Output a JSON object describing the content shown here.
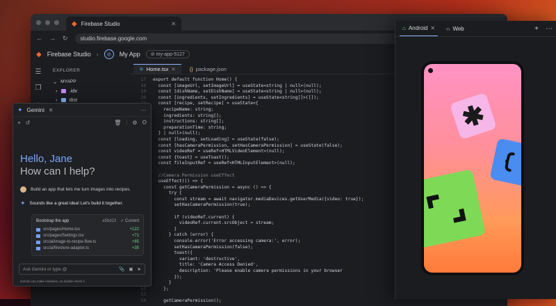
{
  "browser": {
    "tab_title": "Firebase Studio",
    "tab_close": "✕",
    "url": "studio.firebase.google.com"
  },
  "studio": {
    "brand": "Firebase Studio",
    "app_name": "My App",
    "project_id": "my-app-5127"
  },
  "explorer": {
    "header": "EXPLORER",
    "root": "MYAPP",
    "items": [
      ".idx",
      "dist",
      "node_modules"
    ]
  },
  "editor": {
    "tabs": [
      "Home.tsx",
      "package.json"
    ],
    "lines": [
      {
        "n": "17",
        "t": "export default function Home() {"
      },
      {
        "n": "18",
        "t": "  const [imageUrl, setImageUrl] = useState<string | null>(null);"
      },
      {
        "n": "19",
        "t": "  const [dishName, setDishName] = useState<string | null>(null);"
      },
      {
        "n": "20",
        "t": "  const [ingredients, setIngredients] = useState<string[]>([]);"
      },
      {
        "n": "21",
        "t": "  const [recipe, setRecipe] = useState<{"
      },
      {
        "n": "22",
        "t": "    recipeName: string;"
      },
      {
        "n": "23",
        "t": "    ingredients: string[];"
      },
      {
        "n": "24",
        "t": "    instructions: string[];"
      },
      {
        "n": "25",
        "t": "    preparationTime: string;"
      },
      {
        "n": "26",
        "t": "  } | null>(null);"
      },
      {
        "n": "27",
        "t": "  const [loading, setLoading] = useState(false);"
      },
      {
        "n": "28",
        "t": "  const [hasCameraPermission, setHasCameraPermission] = useState(false);"
      },
      {
        "n": "29",
        "t": "  const videoRef = useRef<HTMLVideoElement>(null);"
      },
      {
        "n": "30",
        "t": "  const {toast} = useToast();"
      },
      {
        "n": "31",
        "t": "  const fileInputRef = useRef<HTMLInputElement>(null);"
      },
      {
        "n": "32",
        "t": ""
      },
      {
        "n": "33",
        "t": "  //Camera Permission useEffect"
      },
      {
        "n": "34",
        "t": "  useEffect(() => {"
      },
      {
        "n": "35",
        "t": "    const getCameraPermission = async () => {"
      },
      {
        "n": "36",
        "t": "      try {"
      },
      {
        "n": "37",
        "t": "        const stream = await navigator.mediaDevices.getUserMedia({video: true});"
      },
      {
        "n": "38",
        "t": "        setHasCameraPermission(true);"
      },
      {
        "n": "39",
        "t": ""
      },
      {
        "n": "40",
        "t": "        if (videoRef.current) {"
      },
      {
        "n": "41",
        "t": "          videoRef.current.srcObject = stream;"
      },
      {
        "n": "42",
        "t": "        }"
      },
      {
        "n": "43",
        "t": "      } catch (error) {"
      },
      {
        "n": "44",
        "t": "        console.error('Error accessing camera:', error);"
      },
      {
        "n": "45",
        "t": "        setHasCameraPermission(false);"
      },
      {
        "n": "46",
        "t": "        toast({"
      },
      {
        "n": "47",
        "t": "          variant: 'destructive',"
      },
      {
        "n": "48",
        "t": "          title: 'Camera Access Denied',"
      },
      {
        "n": "49",
        "t": "          description: 'Please enable camera permissions in your browser"
      },
      {
        "n": "50",
        "t": "        });"
      },
      {
        "n": "51",
        "t": "      }"
      },
      {
        "n": "52",
        "t": "    };"
      },
      {
        "n": "53",
        "t": ""
      },
      {
        "n": "54",
        "t": "    getCameraPermission();"
      }
    ]
  },
  "gemini": {
    "title": "Gemini",
    "greeting": "Hello, Jane",
    "subgreeting": "How can I help?",
    "user_message": "Build an app that lets me turn images into recipes.",
    "ai_message": "Sounds like a great idea! Let's build it together.",
    "card": {
      "title": "Bootstrap the app",
      "sha": "a5bd23",
      "status": "Current",
      "files": [
        {
          "path": "src/pages/Home.tsx",
          "delta": "+122"
        },
        {
          "path": "src/pages/Settings.tsx",
          "delta": "+71"
        },
        {
          "path": "src/ai/image-to-recipe-flow.ts",
          "delta": "+85"
        },
        {
          "path": "src/ai/firestore-adapter.ts",
          "delta": "+35"
        }
      ]
    },
    "input_placeholder": "Ask Gemini or type @",
    "disclaimer": "Gemini can make mistakes, so double-check it"
  },
  "preview": {
    "tabs": [
      "Android",
      "Web"
    ]
  }
}
